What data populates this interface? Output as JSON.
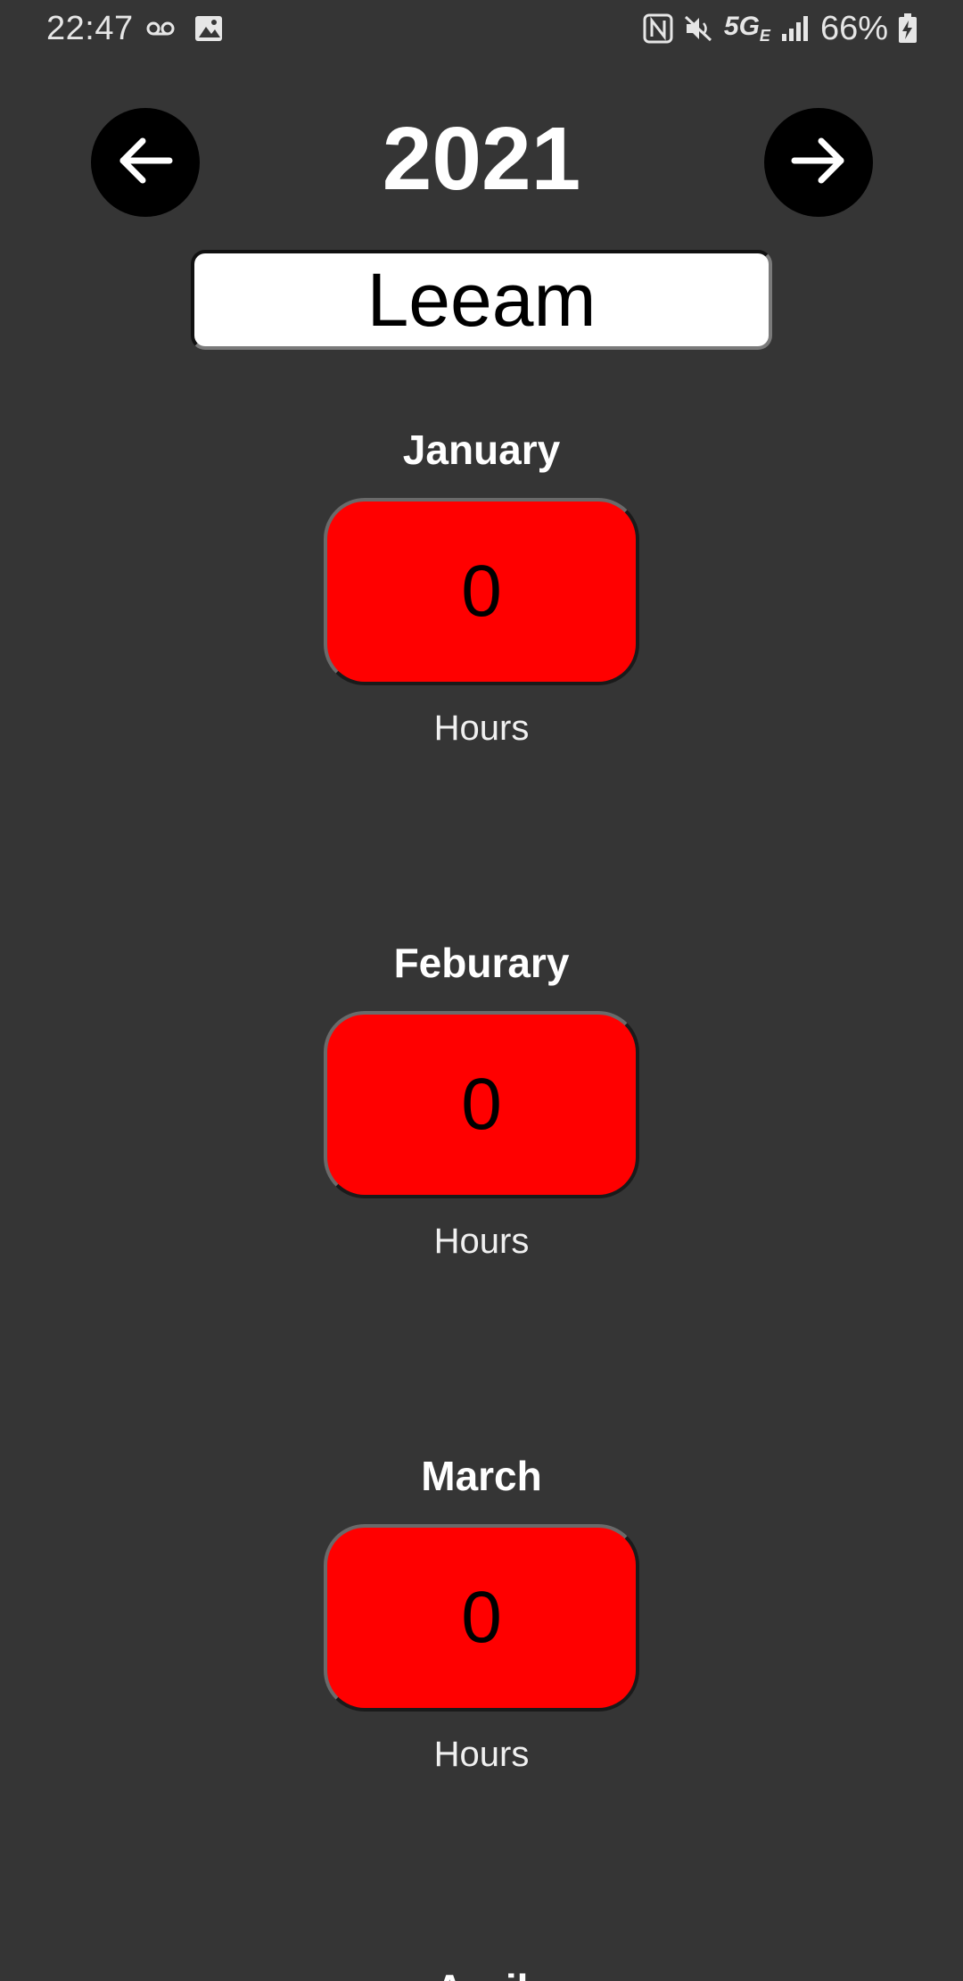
{
  "status_bar": {
    "time": "22:47",
    "left_icons": [
      "voicemail-icon",
      "image-icon"
    ],
    "right_icons": [
      "nfc-icon",
      "mute-icon",
      "signal-icon"
    ],
    "network": "5G",
    "network_sub": "E",
    "battery": "66%"
  },
  "header": {
    "year": "2021",
    "prev_icon": "arrow-left-icon",
    "next_icon": "arrow-right-icon"
  },
  "name_field": {
    "value": "Leeam"
  },
  "months": [
    {
      "name": "January",
      "hours": "0",
      "unit": "Hours"
    },
    {
      "name": "Feburary",
      "hours": "0",
      "unit": "Hours"
    },
    {
      "name": "March",
      "hours": "0",
      "unit": "Hours"
    },
    {
      "name": "April",
      "hours": "",
      "unit": ""
    }
  ],
  "colors": {
    "background": "#353535",
    "hours_box": "#ff0000",
    "nav_button": "#000000"
  }
}
